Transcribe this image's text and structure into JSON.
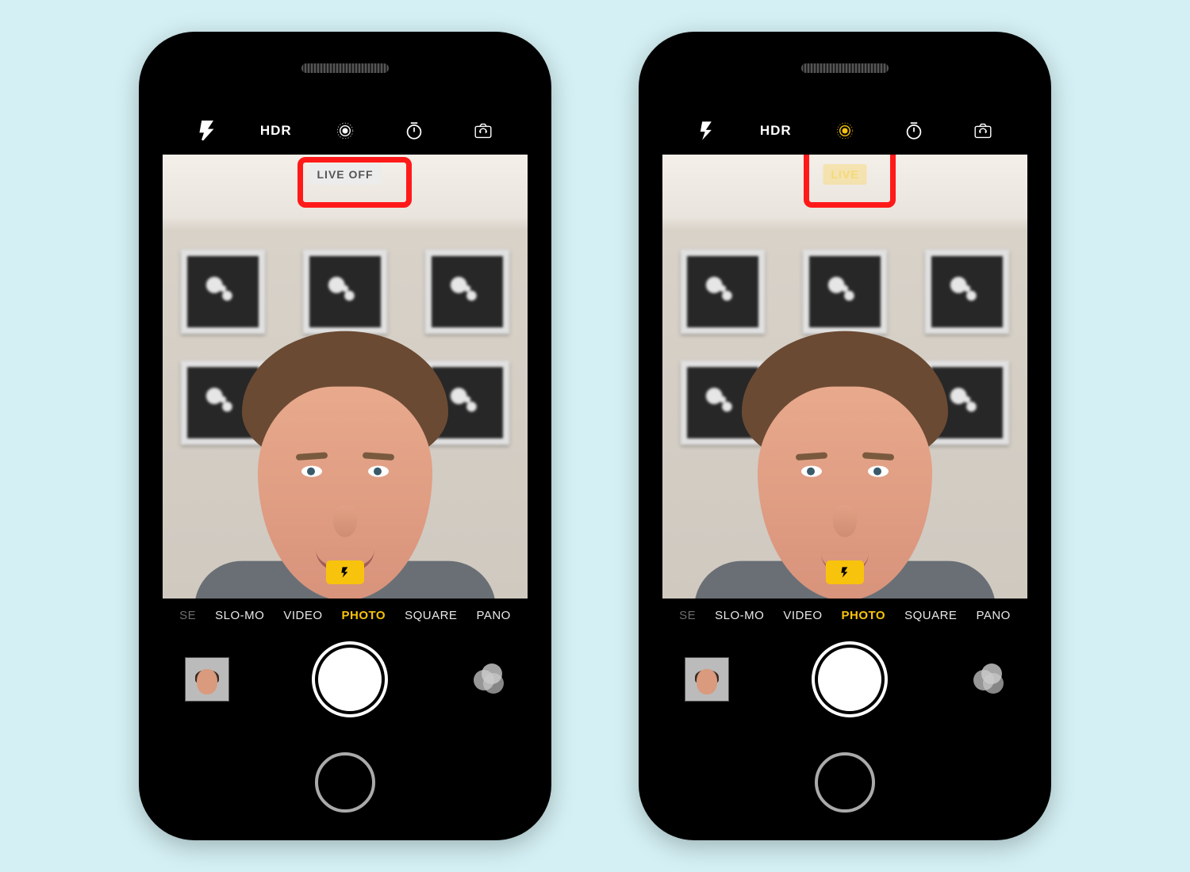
{
  "left_phone": {
    "topbar": {
      "flash_icon": "flash-icon",
      "hdr_label": "HDR",
      "live_photo_icon": "live-photo-icon",
      "live_photo_active": false,
      "timer_icon": "timer-icon",
      "switch_camera_icon": "switch-camera-icon"
    },
    "viewfinder": {
      "status_pill": "LIVE OFF",
      "flash_indicator": "flash-on-chip",
      "annotation": "highlight-live-off-pill"
    },
    "modes": {
      "items": [
        "SE",
        "SLO-MO",
        "VIDEO",
        "PHOTO",
        "SQUARE",
        "PANO"
      ],
      "partial_left": "SE",
      "active_index": 3
    },
    "controls": {
      "last_photo_thumbnail": "thumbnail-button",
      "shutter": "shutter-button",
      "filters": "filters-button"
    }
  },
  "right_phone": {
    "topbar": {
      "flash_icon": "flash-icon",
      "hdr_label": "HDR",
      "live_photo_icon": "live-photo-icon",
      "live_photo_active": true,
      "timer_icon": "timer-icon",
      "switch_camera_icon": "switch-camera-icon"
    },
    "viewfinder": {
      "status_pill": "LIVE",
      "flash_indicator": "flash-on-chip",
      "annotation": "highlight-live-icon"
    },
    "modes": {
      "items": [
        "SE",
        "SLO-MO",
        "VIDEO",
        "PHOTO",
        "SQUARE",
        "PANO"
      ],
      "partial_left": "SE",
      "active_index": 3
    },
    "controls": {
      "last_photo_thumbnail": "thumbnail-button",
      "shutter": "shutter-button",
      "filters": "filters-button"
    }
  },
  "colors": {
    "accent_yellow": "#f8c30c",
    "annotation_red": "#ff1a1a",
    "background": "#d4f0f4"
  }
}
